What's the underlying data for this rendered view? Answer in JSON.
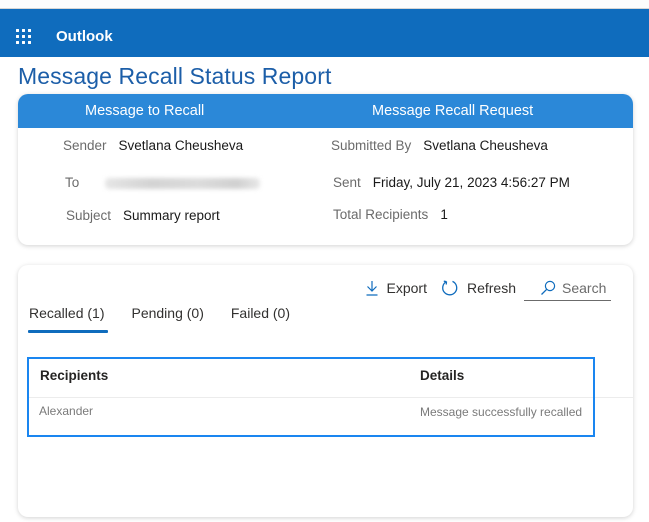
{
  "app": {
    "name": "Outlook",
    "launcher_icon": "app-launcher-waffle-icon"
  },
  "page": {
    "title": "Message Recall Status Report"
  },
  "summary": {
    "left_header": "Message to Recall",
    "right_header": "Message Recall Request",
    "left_fields": [
      {
        "label": "Sender",
        "value": "Svetlana Cheusheva"
      },
      {
        "label": "To",
        "value": ""
      },
      {
        "label": "Subject",
        "value": "Summary report"
      }
    ],
    "right_fields": [
      {
        "label": "Submitted By",
        "value": "Svetlana Cheusheva"
      },
      {
        "label": "Sent",
        "value": "Friday, July 21, 2023 4:56:27  PM"
      },
      {
        "label": "Total Recipients",
        "value": "1"
      }
    ]
  },
  "toolbar": {
    "export_label": "Export",
    "export_icon": "download-icon",
    "refresh_label": "Refresh",
    "refresh_icon": "refresh-icon",
    "search_placeholder": "Search",
    "search_icon": "search-icon"
  },
  "tabs": [
    {
      "label": "Recalled (1)",
      "active": true
    },
    {
      "label": "Pending (0)",
      "active": false
    },
    {
      "label": "Failed (0)",
      "active": false
    }
  ],
  "table": {
    "columns": [
      "Recipients",
      "Details"
    ],
    "rows": [
      [
        "Alexander",
        "Message successfully recalled"
      ]
    ]
  },
  "colors": {
    "app_bar": "#0f6cbd",
    "card_header": "#2b88d8",
    "title": "#1c5ea8",
    "accent": "#0f6cbd",
    "focus_outline": "#1a86f0"
  }
}
